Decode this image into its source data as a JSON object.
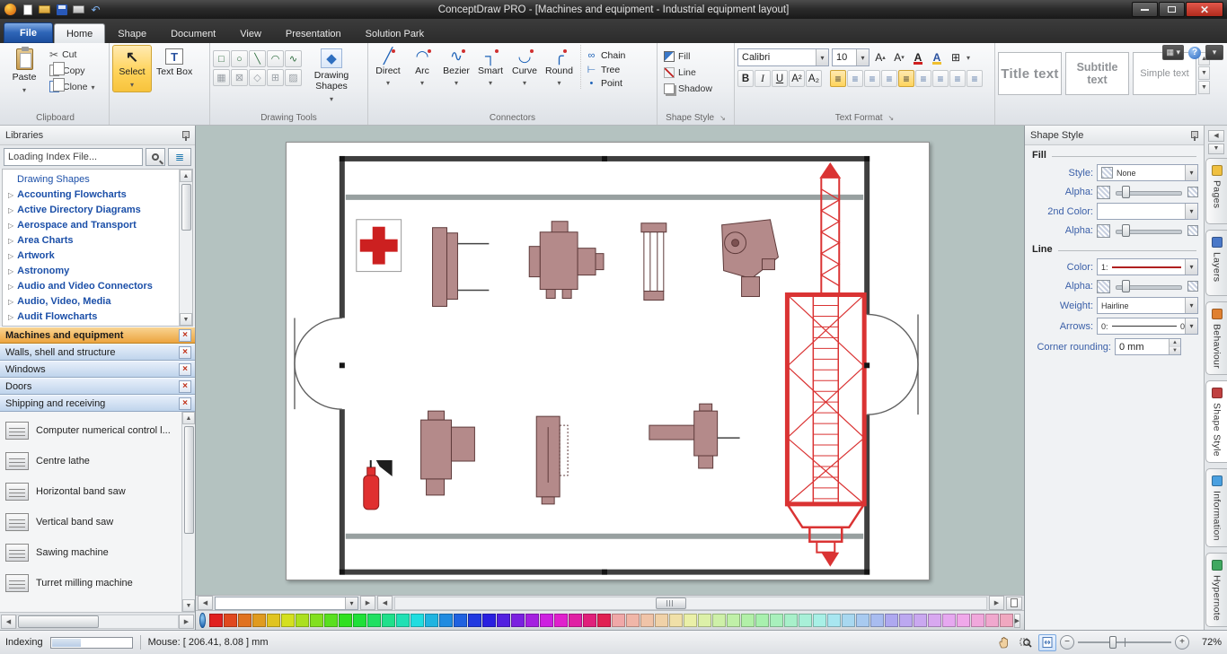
{
  "window": {
    "title": "ConceptDraw PRO - [Machines and equipment - Industrial equipment layout]"
  },
  "menu_tabs": [
    {
      "label": "File",
      "type": "file"
    },
    {
      "label": "Home",
      "active": true
    },
    {
      "label": "Shape"
    },
    {
      "label": "Document"
    },
    {
      "label": "View"
    },
    {
      "label": "Presentation"
    },
    {
      "label": "Solution Park"
    }
  ],
  "ribbon": {
    "clipboard": {
      "group": "Clipboard",
      "paste": "Paste",
      "cut": "Cut",
      "copy": "Copy",
      "clone": "Clone"
    },
    "select": {
      "label": "Select"
    },
    "textbox": {
      "label": "Text Box"
    },
    "drawing": {
      "group": "Drawing Tools",
      "shapes_label": "Drawing Shapes",
      "tools_row1": [
        "□",
        "○",
        "╲",
        "◠",
        "∿"
      ],
      "tools_row2": [
        "▦",
        "⊠",
        "◇",
        "⊞",
        "▨"
      ]
    },
    "connectors": {
      "group": "Connectors",
      "main": [
        {
          "label": "Direct",
          "glyph": "╱"
        },
        {
          "label": "Arc",
          "glyph": "◠"
        },
        {
          "label": "Bezier",
          "glyph": "∿"
        },
        {
          "label": "Smart",
          "glyph": "┐"
        },
        {
          "label": "Curve",
          "glyph": "◡"
        },
        {
          "label": "Round",
          "glyph": "╭"
        }
      ],
      "side": [
        {
          "label": "Chain",
          "glyph": "∞"
        },
        {
          "label": "Tree",
          "glyph": "⊢"
        },
        {
          "label": "Point",
          "glyph": "•"
        }
      ]
    },
    "shape_style_group": {
      "group": "Shape Style",
      "items": [
        {
          "label": "Fill",
          "icon": "fill"
        },
        {
          "label": "Line",
          "icon": "line"
        },
        {
          "label": "Shadow",
          "icon": "shadow"
        }
      ]
    },
    "text_format": {
      "group": "Text Format",
      "font": "Calibri",
      "size": "10",
      "grow": "A",
      "shrink": "A",
      "color_a": "A",
      "highlight_a": "A",
      "font_buttons": [
        "B",
        "I",
        "U",
        "A²",
        "A₂"
      ],
      "align": [
        {
          "active": true
        },
        {},
        {},
        {},
        {
          "active": true
        },
        {},
        {},
        {},
        {}
      ]
    },
    "gallery": [
      {
        "label": "Title text"
      },
      {
        "label": "Subtitle text"
      },
      {
        "label": "Simple text"
      }
    ]
  },
  "libraries": {
    "title": "Libraries",
    "search_text": "Loading Index File...",
    "tree": [
      {
        "label": "Drawing Shapes",
        "plain": true
      },
      {
        "label": "Accounting Flowcharts"
      },
      {
        "label": "Active Directory Diagrams"
      },
      {
        "label": "Aerospace and Transport"
      },
      {
        "label": "Area Charts"
      },
      {
        "label": "Artwork"
      },
      {
        "label": "Astronomy"
      },
      {
        "label": "Audio and Video Connectors"
      },
      {
        "label": "Audio, Video, Media"
      },
      {
        "label": "Audit Flowcharts"
      }
    ],
    "library_tabs": [
      {
        "label": "Machines and equipment",
        "active": true
      },
      {
        "label": "Walls, shell and structure"
      },
      {
        "label": "Windows"
      },
      {
        "label": "Doors"
      },
      {
        "label": "Shipping and receiving"
      }
    ],
    "items": [
      {
        "label": "Computer numerical control l..."
      },
      {
        "label": "Centre lathe"
      },
      {
        "label": "Horizontal band saw"
      },
      {
        "label": "Vertical band saw"
      },
      {
        "label": "Sawing machine"
      },
      {
        "label": "Turret milling machine"
      }
    ]
  },
  "shape_style_panel": {
    "title": "Shape Style",
    "fill_section": "Fill",
    "style_label": "Style:",
    "style_value": "None",
    "alpha_label": "Alpha:",
    "second_color_label": "2nd Color:",
    "alpha2_label": "Alpha:",
    "line_section": "Line",
    "color_label": "Color:",
    "color_value": "1:",
    "line_alpha_label": "Alpha:",
    "weight_label": "Weight:",
    "weight_value": "Hairline",
    "arrows_label": "Arrows:",
    "arrows_value": "0:",
    "arrows_end": "0",
    "corner_label": "Corner rounding:",
    "corner_value": "0 mm"
  },
  "side_tabs": [
    {
      "label": "Pages",
      "color": "#f0c040"
    },
    {
      "label": "Layers",
      "color": "#4a78c8"
    },
    {
      "label": "Behaviour",
      "color": "#e08030"
    },
    {
      "label": "Shape Style",
      "color": "#c04040",
      "active": true
    },
    {
      "label": "Information",
      "color": "#4aa0e0"
    },
    {
      "label": "Hypernote",
      "color": "#40a860"
    }
  ],
  "palette": {
    "colors": [
      "#e02020",
      "#e04920",
      "#e07220",
      "#e09b20",
      "#e0c420",
      "#d4e020",
      "#abe020",
      "#82e020",
      "#59e020",
      "#30e020",
      "#20e039",
      "#20e062",
      "#20e08b",
      "#20e0b4",
      "#20dde0",
      "#20b4e0",
      "#208be0",
      "#2062e0",
      "#2039e0",
      "#2920e0",
      "#5220e0",
      "#7b20e0",
      "#a420e0",
      "#cd20e0",
      "#e020cd",
      "#e020a4",
      "#e0207b",
      "#e02052",
      "#f0a8a8",
      "#f0b6a8",
      "#f0c4a8",
      "#f0d2a8",
      "#f0e0a8",
      "#eaf0a8",
      "#dcf0a8",
      "#cef0a8",
      "#c0f0a8",
      "#b2f0a8",
      "#a8f0ae",
      "#a8f0bc",
      "#a8f0ca",
      "#a8f0d8",
      "#a8f0e6",
      "#a8e6f0",
      "#a8d8f0",
      "#a8caf0",
      "#a8bcf0",
      "#aea8f0",
      "#bca8f0",
      "#caa8f0",
      "#d8a8f0",
      "#e6a8f0",
      "#f0a8ea",
      "#f0a8dc",
      "#f0a8ce",
      "#f0a8c0"
    ]
  },
  "status_bar": {
    "indexing": "Indexing",
    "mouse": "Mouse: [ 206.41, 8.08 ] mm",
    "zoom": "72%"
  }
}
